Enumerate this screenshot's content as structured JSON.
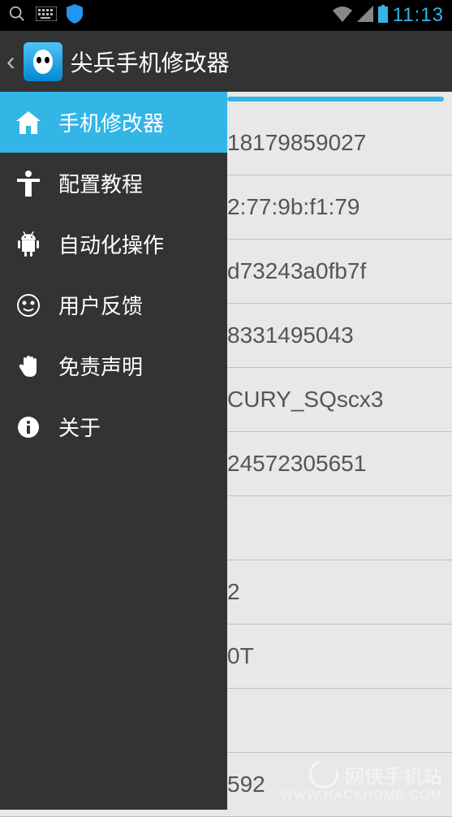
{
  "statusBar": {
    "time": "11:13"
  },
  "header": {
    "title": "尖兵手机修改器"
  },
  "drawer": {
    "items": [
      {
        "label": "手机修改器",
        "icon": "home-icon",
        "active": true
      },
      {
        "label": "配置教程",
        "icon": "accessibility-icon",
        "active": false
      },
      {
        "label": "自动化操作",
        "icon": "android-icon",
        "active": false
      },
      {
        "label": "用户反馈",
        "icon": "face-icon",
        "active": false
      },
      {
        "label": "免责声明",
        "icon": "hand-icon",
        "active": false
      },
      {
        "label": "关于",
        "icon": "info-icon",
        "active": false
      }
    ]
  },
  "content": {
    "rows": [
      "18179859027",
      "2:77:9b:f1:79",
      "d73243a0fb7f",
      "8331495043",
      "CURY_SQscx3",
      "24572305651",
      "",
      "2",
      "0T",
      "",
      "592",
      ""
    ]
  },
  "watermark": {
    "text": "网侠手机站",
    "url": "WWW.HACKHOME.COM"
  }
}
